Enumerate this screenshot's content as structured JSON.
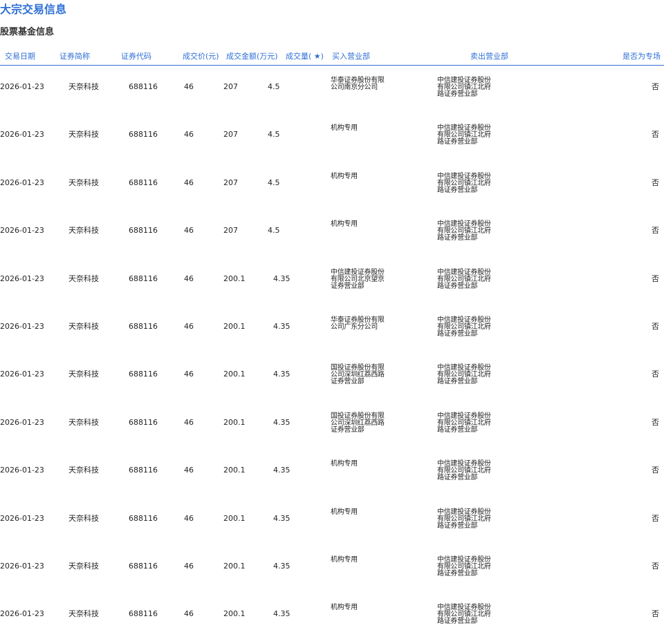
{
  "page_title": "大宗交易信息",
  "section_title": "股票基金信息",
  "columns": [
    "交易日期",
    "证券简称",
    "证券代码",
    "成交价(元)",
    "成交金额(万元)",
    "成交量( ★)",
    "买入营业部",
    "卖出营业部",
    "是否为专场"
  ],
  "rows": [
    {
      "date": "2026-01-23",
      "name": "天奈科技",
      "code": "688116",
      "price": "46",
      "amount": "207",
      "volume": "4.5",
      "buyer": "华泰证券股份有限公司南京分公司",
      "seller": "中信建投证券股份有限公司镇江北府路证券营业部",
      "special": "否"
    },
    {
      "date": "2026-01-23",
      "name": "天奈科技",
      "code": "688116",
      "price": "46",
      "amount": "207",
      "volume": "4.5",
      "buyer": "机构专用",
      "seller": "中信建投证券股份有限公司镇江北府路证券营业部",
      "special": "否"
    },
    {
      "date": "2026-01-23",
      "name": "天奈科技",
      "code": "688116",
      "price": "46",
      "amount": "207",
      "volume": "4.5",
      "buyer": "机构专用",
      "seller": "中信建投证券股份有限公司镇江北府路证券营业部",
      "special": "否"
    },
    {
      "date": "2026-01-23",
      "name": "天奈科技",
      "code": "688116",
      "price": "46",
      "amount": "207",
      "volume": "4.5",
      "buyer": "机构专用",
      "seller": "中信建投证券股份有限公司镇江北府路证券营业部",
      "special": "否"
    },
    {
      "date": "2026-01-23",
      "name": "天奈科技",
      "code": "688116",
      "price": "46",
      "amount": "200.1",
      "volume": "4.35",
      "buyer": "中信建投证券股份有限公司北京望京证券营业部",
      "seller": "中信建投证券股份有限公司镇江北府路证券营业部",
      "special": "否"
    },
    {
      "date": "2026-01-23",
      "name": "天奈科技",
      "code": "688116",
      "price": "46",
      "amount": "200.1",
      "volume": "4.35",
      "buyer": "华泰证券股份有限公司广东分公司",
      "seller": "中信建投证券股份有限公司镇江北府路证券营业部",
      "special": "否"
    },
    {
      "date": "2026-01-23",
      "name": "天奈科技",
      "code": "688116",
      "price": "46",
      "amount": "200.1",
      "volume": "4.35",
      "buyer": "国投证券股份有限公司深圳红荔西路证券营业部",
      "seller": "中信建投证券股份有限公司镇江北府路证券营业部",
      "special": "否"
    },
    {
      "date": "2026-01-23",
      "name": "天奈科技",
      "code": "688116",
      "price": "46",
      "amount": "200.1",
      "volume": "4.35",
      "buyer": "国投证券股份有限公司深圳红荔西路证券营业部",
      "seller": "中信建投证券股份有限公司镇江北府路证券营业部",
      "special": "否"
    },
    {
      "date": "2026-01-23",
      "name": "天奈科技",
      "code": "688116",
      "price": "46",
      "amount": "200.1",
      "volume": "4.35",
      "buyer": "机构专用",
      "seller": "中信建投证券股份有限公司镇江北府路证券营业部",
      "special": "否"
    },
    {
      "date": "2026-01-23",
      "name": "天奈科技",
      "code": "688116",
      "price": "46",
      "amount": "200.1",
      "volume": "4.35",
      "buyer": "机构专用",
      "seller": "中信建投证券股份有限公司镇江北府路证券营业部",
      "special": "否"
    },
    {
      "date": "2026-01-23",
      "name": "天奈科技",
      "code": "688116",
      "price": "46",
      "amount": "200.1",
      "volume": "4.35",
      "buyer": "机构专用",
      "seller": "中信建投证券股份有限公司镇江北府路证券营业部",
      "special": "否"
    },
    {
      "date": "2026-01-23",
      "name": "天奈科技",
      "code": "688116",
      "price": "46",
      "amount": "200.1",
      "volume": "4.35",
      "buyer": "机构专用",
      "seller": "中信建投证券股份有限公司镇江北府路证券营业部",
      "special": "否"
    }
  ]
}
